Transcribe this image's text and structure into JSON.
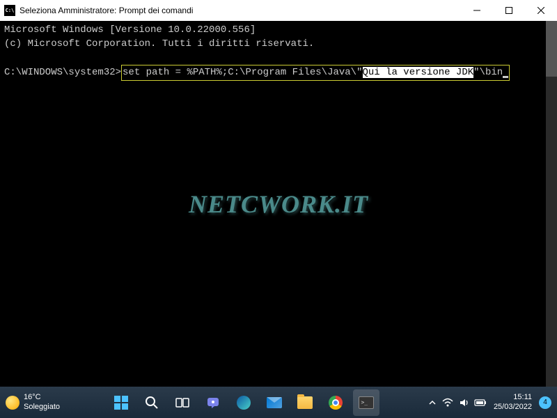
{
  "window": {
    "icon_text": "C:\\",
    "title": "Seleziona Amministratore: Prompt dei comandi"
  },
  "terminal": {
    "line1": "Microsoft Windows [Versione 10.0.22000.556]",
    "line2": "(c) Microsoft Corporation. Tutti i diritti riservati.",
    "prompt": "C:\\WINDOWS\\system32>",
    "cmd_before": "set path = %PATH%;C:\\Program Files\\Java\\\"",
    "cmd_selected": "Qui la versione JDK",
    "cmd_after": "\"\\bin"
  },
  "watermark": "NETCWORK.IT",
  "taskbar": {
    "weather": {
      "temp": "16°C",
      "condition": "Soleggiato"
    },
    "clock": {
      "time": "15:11",
      "date": "25/03/2022"
    },
    "notif_count": "4",
    "cmd_prompt": ">_"
  }
}
